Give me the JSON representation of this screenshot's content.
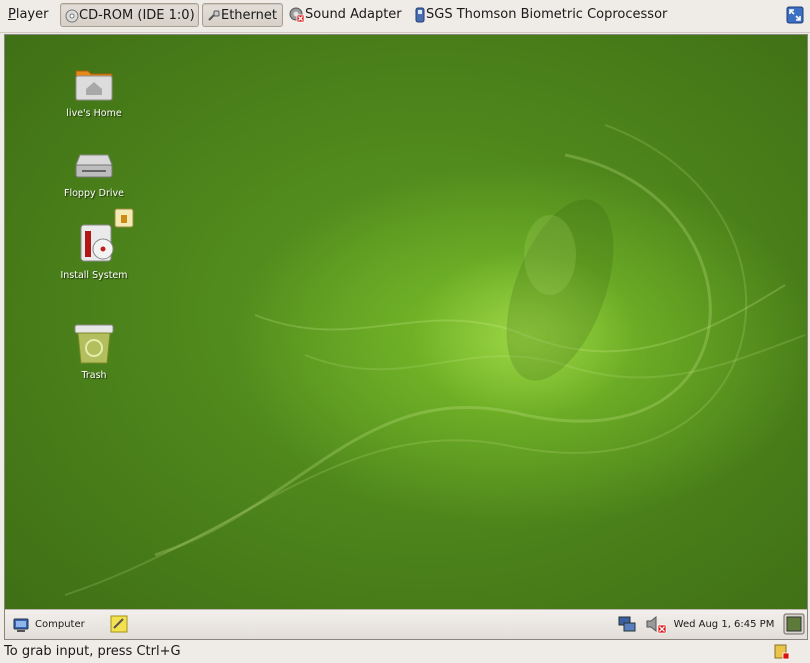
{
  "menubar": {
    "player_label": "Player",
    "player_mnemonic": "P",
    "player_rest": "layer",
    "devices": {
      "cdrom": "CD-ROM (IDE 1:0)",
      "ethernet": "Ethernet",
      "sound": "Sound Adapter",
      "biometric": "SGS Thomson Biometric Coprocessor"
    },
    "icons": {
      "cdrom": "cd-disc-icon",
      "ethernet": "network-plug-icon",
      "sound": "sound-card-disconnected-icon",
      "biometric": "usb-device-icon",
      "fullscreen": "fullscreen-icon"
    }
  },
  "desktop": {
    "icons": [
      {
        "label": "live's Home",
        "icon": "home-folder-icon"
      },
      {
        "label": "Floppy Drive",
        "icon": "floppy-drive-icon"
      },
      {
        "label": "Install System",
        "icon": "install-system-icon"
      },
      {
        "label": "Trash",
        "icon": "trash-icon"
      }
    ],
    "accent_color": "#6fb224"
  },
  "panel": {
    "computer_label": "Computer",
    "clock": "Wed Aug  1,  6:45 PM",
    "icons": {
      "computer": "computer-monitor-icon",
      "notes": "sticky-notes-icon",
      "network": "network-status-icon",
      "volume": "volume-muted-icon",
      "show_desktop": "show-desktop-icon"
    }
  },
  "statusbar": {
    "hint": "To grab input, press Ctrl+G",
    "icon": "vm-tools-warning-icon"
  }
}
